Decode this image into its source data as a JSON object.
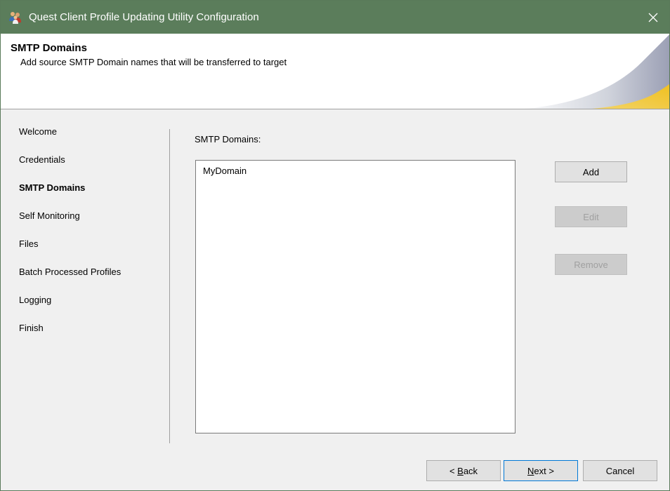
{
  "window": {
    "title": "Quest Client Profile Updating Utility Configuration",
    "close_symbol": "✕",
    "titlebar_color": "#5b7d5b"
  },
  "header": {
    "title": "SMTP Domains",
    "subtitle": "Add source SMTP Domain names that will be transferred to target"
  },
  "nav": {
    "items": [
      {
        "label": "Welcome",
        "active": false
      },
      {
        "label": "Credentials",
        "active": false
      },
      {
        "label": "SMTP Domains",
        "active": true
      },
      {
        "label": "Self Monitoring",
        "active": false
      },
      {
        "label": "Files",
        "active": false
      },
      {
        "label": "Batch Processed Profiles",
        "active": false
      },
      {
        "label": "Logging",
        "active": false
      },
      {
        "label": "Finish",
        "active": false
      }
    ]
  },
  "content": {
    "label": "SMTP Domains:",
    "domains": [
      "MyDomain"
    ]
  },
  "actions": {
    "add": "Add",
    "edit": "Edit",
    "remove": "Remove",
    "edit_enabled": false,
    "remove_enabled": false
  },
  "footer": {
    "back_accel": "B",
    "back_prefix": "< ",
    "back_rest": "ack",
    "next_accel": "N",
    "next_rest": "ext >",
    "cancel": "Cancel"
  },
  "icons": {
    "app": "people-icon",
    "close": "close-icon"
  }
}
